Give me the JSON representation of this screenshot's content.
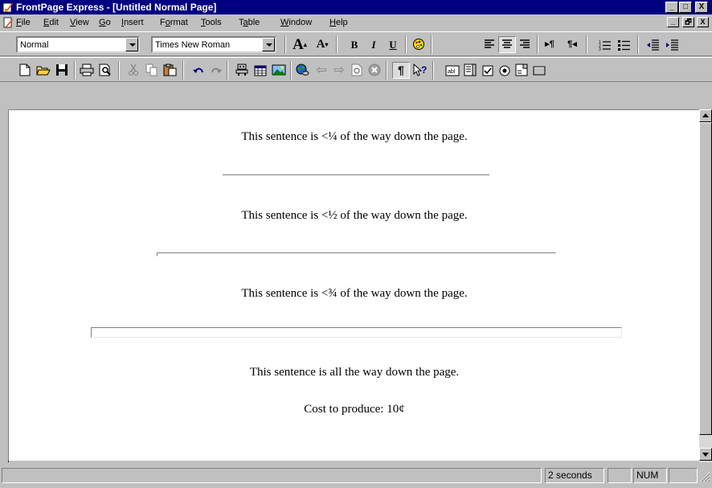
{
  "window": {
    "title": "FrontPage Express - [Untitled Normal Page]",
    "controls": [
      "_",
      "□",
      "X"
    ],
    "mdi_controls": [
      "_",
      "🗗",
      "X"
    ]
  },
  "menu": [
    {
      "accel": "F",
      "rest": "ile"
    },
    {
      "accel": "E",
      "rest": "dit"
    },
    {
      "accel": "V",
      "rest": "iew"
    },
    {
      "accel": "G",
      "rest": "o"
    },
    {
      "accel": "I",
      "rest": "nsert"
    },
    {
      "pre": "F",
      "accel": "o",
      "rest": "rmat"
    },
    {
      "accel": "T",
      "rest": "ools"
    },
    {
      "pre": "T",
      "accel": "a",
      "rest": "ble"
    },
    {
      "accel": "W",
      "rest": "indow"
    },
    {
      "accel": "H",
      "rest": "elp"
    }
  ],
  "format_toolbar": {
    "style_value": "Normal",
    "font_value": "Times New Roman",
    "buttons": {
      "increase_text": "A",
      "decrease_text": "A",
      "bold": "B",
      "italic": "I",
      "underline": "U",
      "para_ltr": "▸¶",
      "para_rtl": "¶◂"
    }
  },
  "document": {
    "line1": "This sentence is <¼ of the way down the page.",
    "line2": "This sentence is <½ of the way down the page.",
    "line3": "This sentence is <¾ of the way down the page.",
    "line4": "This sentence is all the way down the page.",
    "line5": "Cost to produce: 10¢"
  },
  "status": {
    "time": "2 seconds",
    "num": "NUM"
  },
  "colors": {
    "title_bar": "#000080",
    "chrome": "#c0c0c0",
    "page": "#ffffff"
  }
}
